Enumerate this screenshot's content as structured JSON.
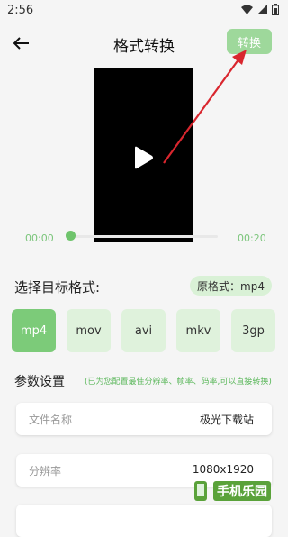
{
  "status": {
    "time": "2:56"
  },
  "header": {
    "title": "格式转换",
    "convert_label": "转换"
  },
  "player": {
    "current_time": "00:00",
    "duration": "00:20",
    "progress": 0.0
  },
  "format": {
    "section_label": "选择目标格式:",
    "original": "原格式：mp4",
    "options": [
      "mp4",
      "mov",
      "avi",
      "mkv",
      "3gp"
    ],
    "selected": "mp4"
  },
  "params": {
    "label": "参数设置",
    "hint": "(已为您配置最佳分辨率、帧率、码率,可以直接转换)",
    "fields": [
      {
        "label": "文件名称",
        "value": "极光下载站"
      },
      {
        "label": "分辨率",
        "value": "1080x1920"
      }
    ]
  },
  "watermark": {
    "text": "手机乐园"
  },
  "colors": {
    "accent": "#7ccb79",
    "accent_light": "#dff2dc",
    "arrow": "#d9262e"
  }
}
